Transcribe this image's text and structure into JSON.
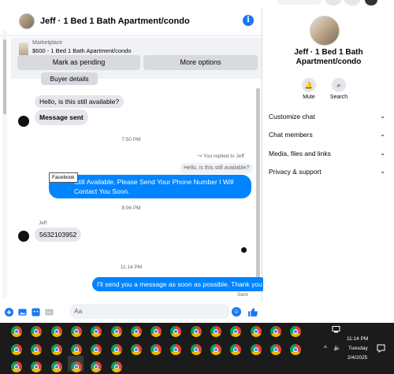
{
  "chat": {
    "title": "Jeff · 1 Bed 1 Bath Apartment/condo",
    "info_icon": "info-icon",
    "marketplace": {
      "label": "Marketplace",
      "listing": "$600 - 1 Bed 1 Bath Apartment/condo",
      "mark_pending": "Mark as pending",
      "more_options": "More options"
    },
    "messages": {
      "buyer_details": "Buyer details",
      "q1": "Hello, is this still available?",
      "message_sent": "Message sent",
      "time1": "7:50 PM",
      "replied_to": "You replied to Jeff",
      "quoted": "Hello, is this still available?",
      "reply_text": "Still Available, Please Send Your Phone Number I Will Contact You Soon.",
      "tooltip": "Facebook",
      "time2": "8:06 PM",
      "sender": "Jeff",
      "phone": "5632103952",
      "time3": "11:14 PM",
      "final_out": "I'll send you a message as soon as possible. Thank you",
      "sent_status": "Sent"
    },
    "composer": {
      "placeholder": "Aa"
    }
  },
  "panel": {
    "name": "Jeff · 1 Bed 1 Bath Apartment/condo",
    "mute": "Mute",
    "search": "Search",
    "sections": [
      "Customize chat",
      "Chat members",
      "Media, files and links",
      "Privacy & support"
    ]
  },
  "taskbar": {
    "time": "11:14 PM",
    "day": "Tuesday",
    "date": "2/4/2025"
  },
  "colors": {
    "accent": "#0084ff",
    "brand": "#1877f2"
  }
}
